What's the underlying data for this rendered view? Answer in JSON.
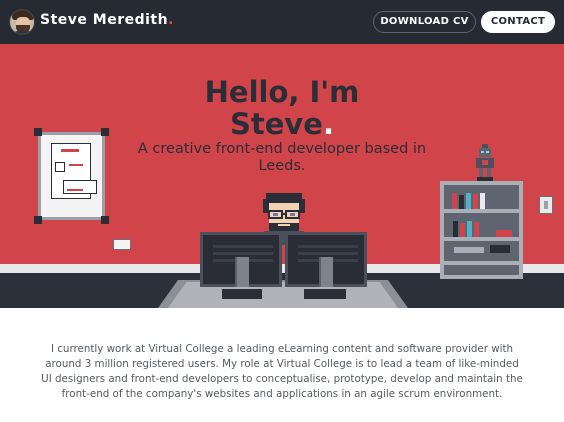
{
  "header": {
    "brand_name": "Steve Meredith",
    "brand_dot": ".",
    "download_cv_label": "DOWNLOAD CV",
    "contact_label": "CONTACT"
  },
  "hero": {
    "title_line1": "Hello, I'm",
    "title_line2": "Steve",
    "title_dot": ".",
    "subtitle": "A creative front-end developer based in Leeds."
  },
  "intro": {
    "text": "I currently work at Virtual College a leading eLearning content and software provider with around 3 million registered users. My role at Virtual College is to lead a team of like-minded UI designers and front-end developers to conceptualise, prototype, develop and maintain the front-end of the company's websites and applications in an agile scrum environment."
  },
  "colors": {
    "header_bg": "#262a33",
    "hero_bg": "#d0444a",
    "accent": "#e2474b",
    "text_dark": "#2b2e36",
    "body_text": "#555a63"
  },
  "icons": [
    "avatar",
    "whiteboard-illustration",
    "socket-icon",
    "light-switch-icon",
    "bookshelf-illustration",
    "robot-toy-icon",
    "developer-character",
    "monitor-illustration"
  ]
}
